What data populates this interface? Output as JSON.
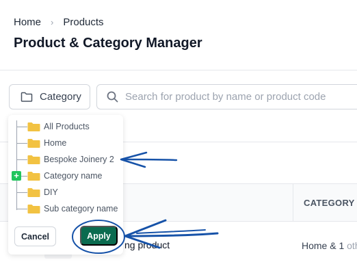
{
  "breadcrumb": {
    "home": "Home",
    "separator": "›",
    "current": "Products"
  },
  "page": {
    "title": "Product & Category Manager"
  },
  "toolbar": {
    "category_label": "Category",
    "category_icon": "folder-icon",
    "search_placeholder": "Search for product by name or product code",
    "search_icon": "search-icon"
  },
  "category_tree": {
    "items": [
      {
        "label": "All Products"
      },
      {
        "label": "Home"
      },
      {
        "label": "Bespoke Joinery 2"
      },
      {
        "label": "Category name",
        "expandable": true,
        "expand_symbol": "+"
      },
      {
        "label": "DIY"
      },
      {
        "label": "Sub category name"
      }
    ],
    "cancel_label": "Cancel",
    "apply_label": "Apply"
  },
  "table": {
    "column_header": "CATEGORY",
    "row": {
      "name_visible": "ng product",
      "category_main": "Home & 1",
      "category_muted": " oth"
    }
  },
  "colors": {
    "accent": "#0b6b4f",
    "expand": "#22c55e",
    "folder": "#f2c242",
    "annotation": "#1652a8"
  }
}
